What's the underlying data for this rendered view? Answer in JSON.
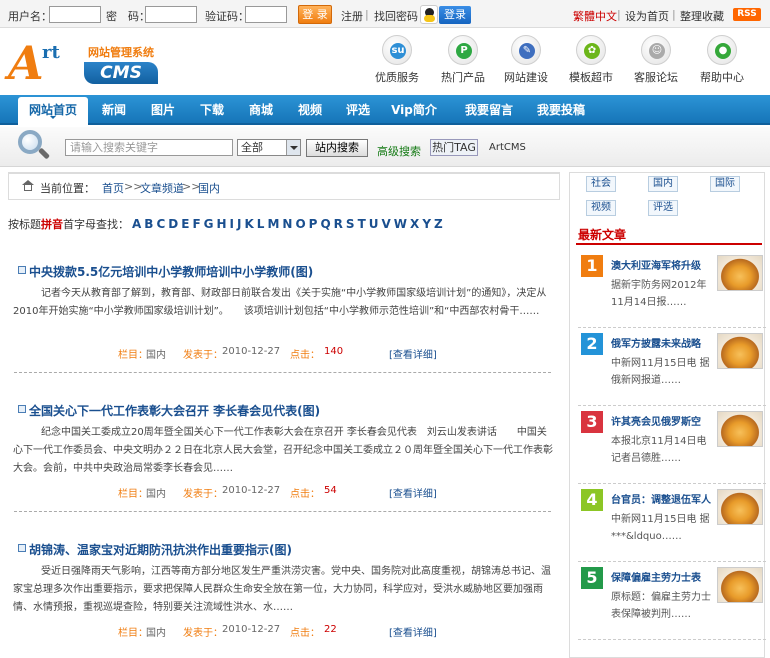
{
  "topbar": {
    "username_label": "用户名：",
    "password_label": "密　码：",
    "captcha_label": "验证码：",
    "login_btn": "登 录",
    "register": "注册",
    "forgot": "找回密码",
    "qq_login": "登录",
    "traditional": "繁體中文",
    "set_home": "设为首页",
    "bookmark": "整理收藏",
    "rss": "RSS"
  },
  "logo": {
    "a": "A",
    "rt": "rt",
    "system": "网站管理系统",
    "cms": "CMS"
  },
  "header_nav": [
    {
      "label": "优质服务",
      "icon": "su-icon",
      "glyph": "su",
      "color": "#2e8fd6"
    },
    {
      "label": "热门产品",
      "icon": "p-icon",
      "glyph": "P",
      "color": "#2ea843"
    },
    {
      "label": "网站建设",
      "icon": "tools-icon",
      "glyph": "✎",
      "color": "#3f6fbf"
    },
    {
      "label": "模板超市",
      "icon": "leaf-icon",
      "glyph": "✿",
      "color": "#6cb61a"
    },
    {
      "label": "客服论坛",
      "icon": "smile-icon",
      "glyph": "☺",
      "color": "#aaaaaa"
    },
    {
      "label": "帮助中心",
      "icon": "chat-icon",
      "glyph": "●",
      "color": "#35a83a"
    }
  ],
  "main_nav": [
    "网站首页",
    "新闻",
    "图片",
    "下载",
    "商城",
    "视频",
    "评选",
    "Vip简介",
    "我要留言",
    "我要投稿"
  ],
  "search": {
    "placeholder": "请输入搜索关键字",
    "category": "全部",
    "button": "站内搜索",
    "advanced": "高级搜索",
    "tag_button": "热门TAG",
    "tag_text": "ArtCMS"
  },
  "breadcrumb": {
    "label": "当前位置：",
    "items": [
      "首页",
      "文章频道",
      "国内"
    ],
    "sep": ">>"
  },
  "letter_filter": {
    "prefix": "按标题",
    "highlight": "拼音",
    "suffix": "首字母查找：",
    "letters": [
      "A",
      "B",
      "C",
      "D",
      "E",
      "F",
      "G",
      "H",
      "I",
      "J",
      "K",
      "L",
      "M",
      "N",
      "O",
      "P",
      "Q",
      "R",
      "S",
      "T",
      "U",
      "V",
      "W",
      "X",
      "Y",
      "Z"
    ]
  },
  "meta_labels": {
    "column": "栏目：",
    "published": "发表于：",
    "hits": "点击：",
    "detail": "[查看详细]"
  },
  "articles": [
    {
      "title": "中央拨款5.5亿元培训中小学教师培训中小学教师(图)",
      "body": "记者今天从教育部了解到，教育部、财政部日前联合发出《关于实施“中小学教师国家级培训计划”的通知》，决定从2010年开始实施“中小学教师国家级培训计划”。　　该项培训计划包括“中小学教师示范性培训”和“中西部农村骨干……",
      "column": "国内",
      "date": "2010-12-27",
      "hits": "140"
    },
    {
      "title": "全国关心下一代工作表彰大会召开 李长春会见代表(图)",
      "body": "纪念中国关工委成立20周年暨全国关心下一代工作表彰大会在京召开 李长春会见代表　刘云山发表讲话　　中国关心下一代工作委员会、中央文明办２２日在北京人民大会堂，召开纪念中国关工委成立２０周年暨全国关心下一代工作表彰大会。会前，中共中央政治局常委李长春会见……",
      "column": "国内",
      "date": "2010-12-27",
      "hits": "54"
    },
    {
      "title": "胡锦涛、温家宝对近期防汛抗洪作出重要指示(图)",
      "body": "受近日强降雨天气影响，江西等南方部分地区发生严重洪涝灾害。党中央、国务院对此高度重视，胡锦涛总书记、温家宝总理多次作出重要指示，要求把保障人民群众生命安全放在第一位，大力协同，科学应对，受洪水威胁地区要加强雨情、水情预报，重视巡堤查险，特别要关注流域性洪水、水……",
      "column": "国内",
      "date": "2010-12-27",
      "hits": "22"
    }
  ],
  "right_tags": [
    "社会",
    "国内",
    "国际",
    "视频",
    "评选"
  ],
  "latest": {
    "title": "最新文章",
    "items": [
      {
        "num": "1",
        "color": "#f07d10",
        "title": "澳大利亚海军将升级",
        "desc": "据新宇防务网2012年11月14日报……"
      },
      {
        "num": "2",
        "color": "#2393d8",
        "title": "俄军方披露未来战略",
        "desc": "中新网11月15日电 据俄新网报道……"
      },
      {
        "num": "3",
        "color": "#d9343f",
        "title": "许其亮会见俄罗斯空",
        "desc": "本报北京11月14日电 记者吕德胜……"
      },
      {
        "num": "4",
        "color": "#8cc625",
        "title": "台官员：调整退伍军人",
        "desc": "中新网11月15日电 据***&ldquo……"
      },
      {
        "num": "5",
        "color": "#239a4a",
        "title": "保障偏雇主劳力士表",
        "desc": "原标题：偏雇主劳力士表保障被判刑……"
      }
    ]
  }
}
